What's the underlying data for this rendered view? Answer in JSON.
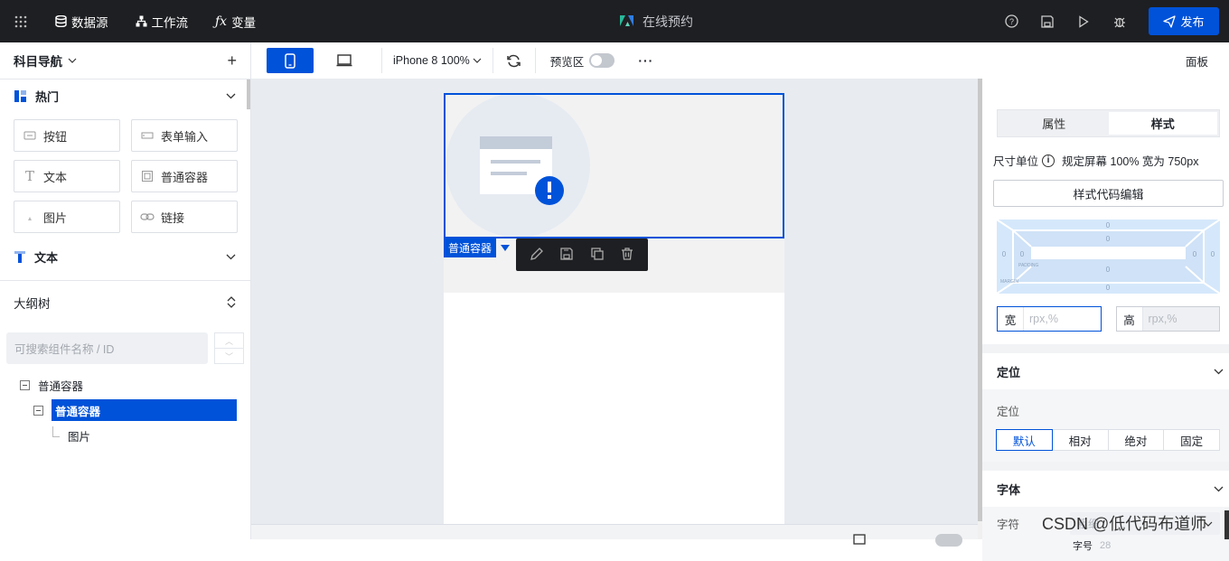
{
  "topbar": {
    "datasource": "数据源",
    "workflow": "工作流",
    "variables": "变量",
    "title": "在线预约",
    "publish": "发布"
  },
  "toolbar": {
    "device": "iPhone 8 100%",
    "preview_label": "预览区",
    "more": "···",
    "panel": "面板"
  },
  "left": {
    "nav_title": "科目导航",
    "hot_section": "热门",
    "components": [
      {
        "label": "按钮"
      },
      {
        "label": "表单输入"
      },
      {
        "label": "文本"
      },
      {
        "label": "普通容器"
      },
      {
        "label": "图片"
      },
      {
        "label": "链接"
      }
    ],
    "text_section": "文本",
    "outline_title": "大纲树",
    "search_placeholder": "可搜索组件名称 / ID",
    "tree": [
      {
        "label": "普通容器"
      },
      {
        "label": "普通容器"
      },
      {
        "label": "图片"
      }
    ]
  },
  "canvas": {
    "selected_tag": "普通容器"
  },
  "right": {
    "tabs": [
      "属性",
      "样式"
    ],
    "unit_label": "尺寸单位",
    "unit_value": "规定屏幕 100% 宽为 750px",
    "code_button": "样式代码编辑",
    "box_values": [
      "0",
      "0",
      "0",
      "0",
      "0",
      "0",
      "0",
      "0",
      "0",
      "0"
    ],
    "padding_label": "PADDING",
    "margin_label": "MARGIN",
    "width_label": "宽",
    "width_placeholder": "rpx,%",
    "height_label": "高",
    "height_placeholder": "rpx,%",
    "position_group": "定位",
    "position_label": "定位",
    "position_options": [
      "默认",
      "相对",
      "绝对",
      "固定"
    ],
    "font_group": "字体",
    "font_label": "字符",
    "font_weight_placeholder": "粗细",
    "font_size_label": "字号",
    "font_size_value": "28"
  },
  "watermark": "CSDN @低代码布道师"
}
